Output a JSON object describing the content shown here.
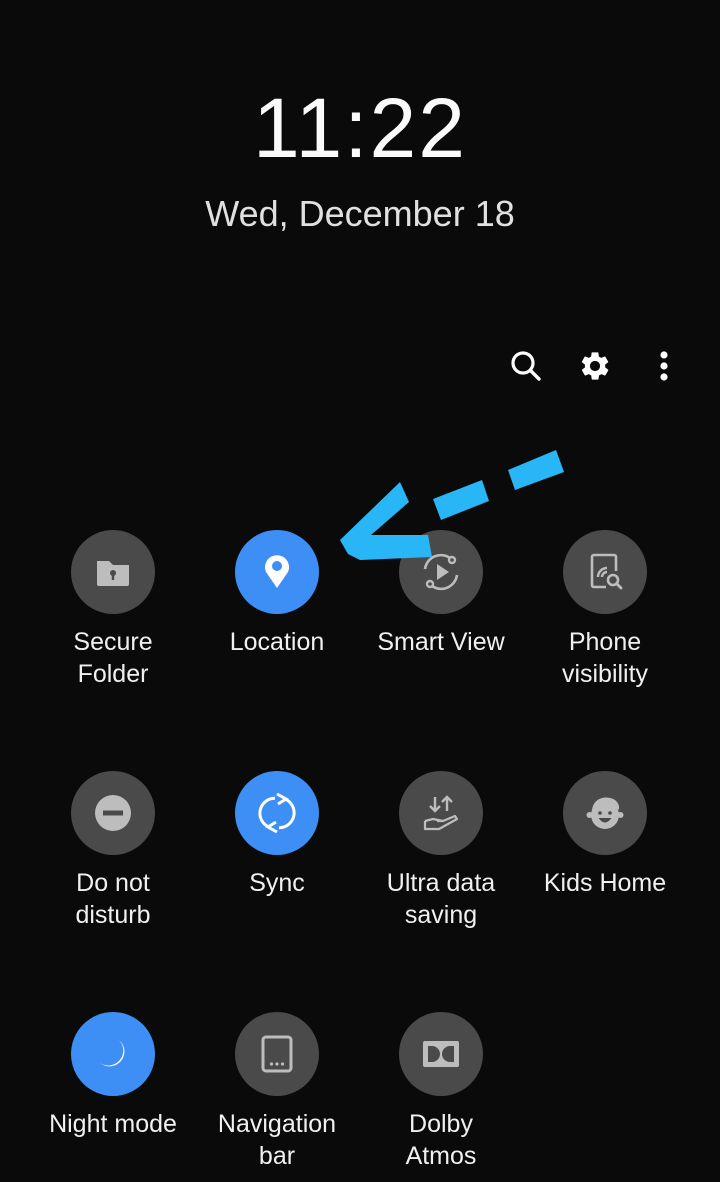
{
  "lockscreen": {
    "time": "11:22",
    "date": "Wed, December 18"
  },
  "toolbar": {
    "buttons": [
      {
        "name": "search",
        "icon": "search-icon"
      },
      {
        "name": "settings",
        "icon": "gear-icon"
      },
      {
        "name": "more-options",
        "icon": "more-vertical-icon"
      }
    ]
  },
  "quick_settings": {
    "tiles": [
      {
        "label": "Secure\nFolder",
        "icon": "secure-folder-icon",
        "state": "off"
      },
      {
        "label": "Location",
        "icon": "location-pin-icon",
        "state": "on"
      },
      {
        "label": "Smart View",
        "icon": "smart-view-icon",
        "state": "off"
      },
      {
        "label": "Phone\nvisibility",
        "icon": "phone-visibility-icon",
        "state": "off"
      },
      {
        "label": "Do not\ndisturb",
        "icon": "do-not-disturb-icon",
        "state": "off"
      },
      {
        "label": "Sync",
        "icon": "sync-icon",
        "state": "on"
      },
      {
        "label": "Ultra data\nsaving",
        "icon": "data-saving-icon",
        "state": "off"
      },
      {
        "label": "Kids Home",
        "icon": "kids-home-icon",
        "state": "off"
      },
      {
        "label": "Night mode",
        "icon": "moon-icon",
        "state": "on"
      },
      {
        "label": "Navigation\nbar",
        "icon": "navigation-bar-icon",
        "state": "off"
      },
      {
        "label": "Dolby\nAtmos",
        "icon": "dolby-icon",
        "state": "off"
      }
    ]
  },
  "annotation": {
    "type": "dashed-arrow",
    "color": "#29b6f6",
    "points_to": "Location"
  },
  "colors": {
    "background": "#0a0a0a",
    "tile_on": "#3d8ef5",
    "tile_off": "#4a4a4a",
    "icon_off": "#bdbdbd"
  }
}
